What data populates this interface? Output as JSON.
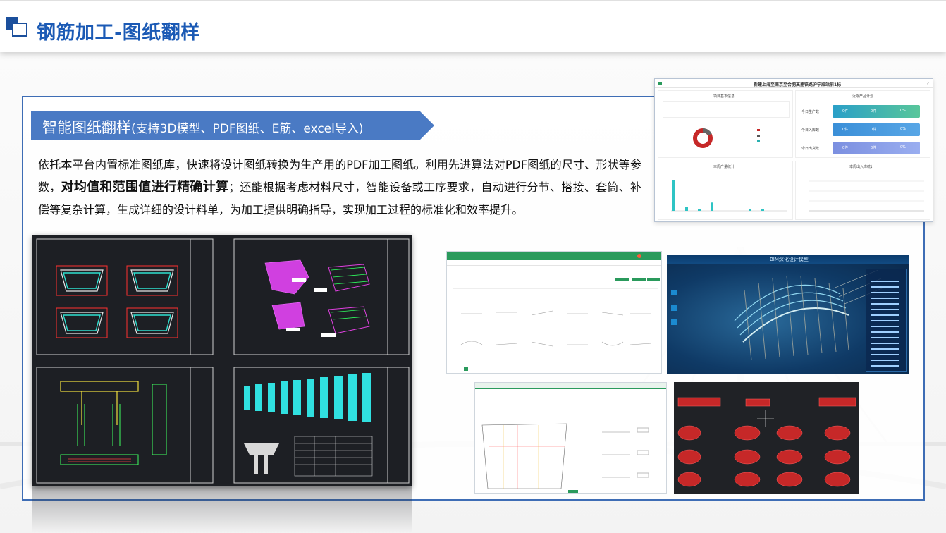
{
  "header": {
    "title": "钢筋加工-图纸翻样"
  },
  "section": {
    "title_main": "智能图纸翻样",
    "title_sub": "(支持3D模型、PDF图纸、E筋、excel导入)"
  },
  "description": {
    "part1": "依托本平台内置标准图纸库，快速将设计图纸转换为生产用的PDF加工图纸。利用先进算法对PDF图纸的尺寸、形状等参数，",
    "bold": "对均值和范围值进行精确计算",
    "part2": "；还能根据考虑材料尺寸，智能设备或工序要求，自动进行分节、搭接、套筒、补偿等复杂计算，生成详细的设计料单，为加工提供明确指导，实现加工过程的标准化和效率提升。"
  },
  "dashboard": {
    "project_title": "新建上海至南京至合肥高速铁路沪宁段站前1标",
    "panel_basic": "项目基本信息",
    "panel_plan": "近期产品计划",
    "panel_week": "本周产量统计",
    "panel_inout": "本周出入库统计",
    "plan_rows": [
      {
        "label": "今日生产数",
        "a": "0件",
        "b": "0件",
        "c": "0%"
      },
      {
        "label": "今日入库数",
        "a": "0件",
        "b": "0件",
        "c": "0%"
      },
      {
        "label": "今日出货数",
        "a": "0件",
        "b": "0件",
        "c": "0%"
      }
    ],
    "bar_values": [
      15,
      2,
      1,
      4,
      0,
      0,
      1,
      1,
      0
    ]
  },
  "bim": {
    "title": "BIM深化设计模型"
  },
  "colors": {
    "accent": "#1b5ab5",
    "frame": "#3e6db5",
    "banner": "#4a7ac4",
    "green": "#2a9a5c"
  }
}
